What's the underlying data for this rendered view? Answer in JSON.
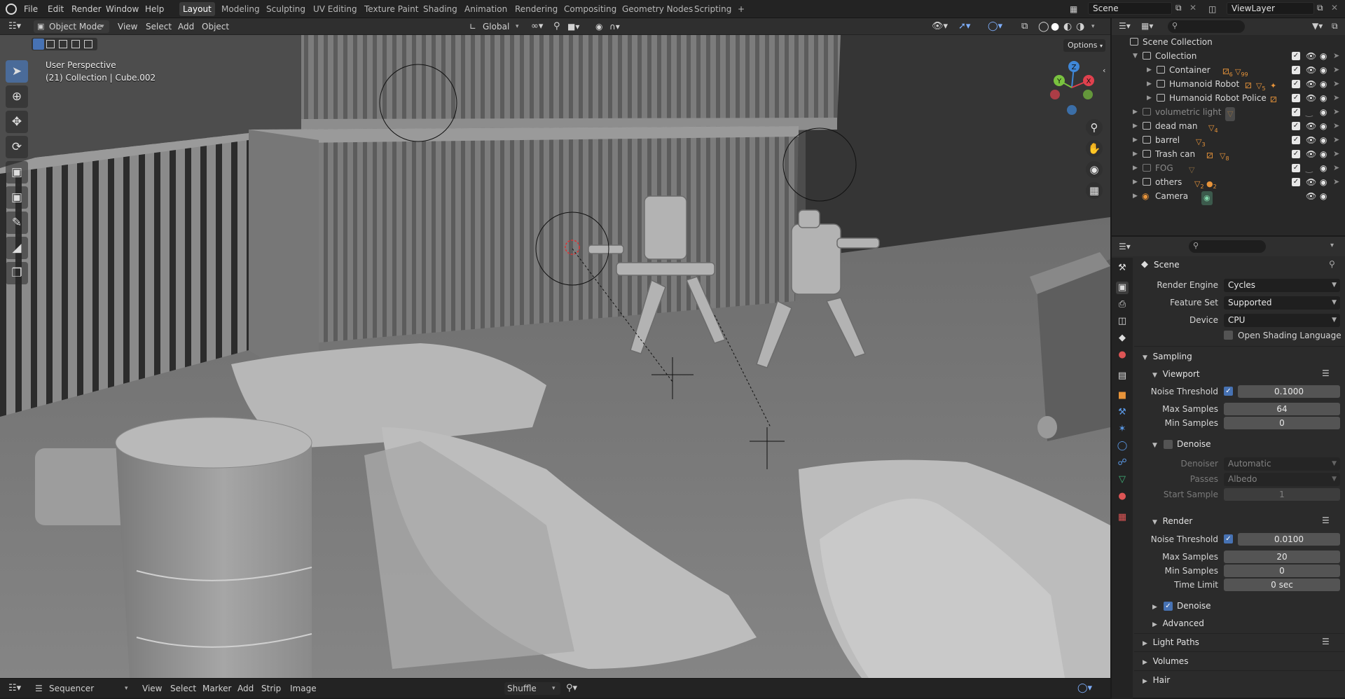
{
  "topbar": {
    "menus": [
      "File",
      "Edit",
      "Render",
      "Window",
      "Help"
    ],
    "workspaces": [
      "Layout",
      "Modeling",
      "Sculpting",
      "UV Editing",
      "Texture Paint",
      "Shading",
      "Animation",
      "Rendering",
      "Compositing",
      "Geometry Nodes",
      "Scripting"
    ],
    "active_workspace": "Layout",
    "add_tab": "+",
    "scene_name": "Scene",
    "view_layer": "ViewLayer"
  },
  "viewport_header": {
    "mode": "Object Mode",
    "menus": [
      "View",
      "Select",
      "Add",
      "Object"
    ],
    "orientation": "Global",
    "options": "Options"
  },
  "viewport": {
    "perspective_label": "User Perspective",
    "collection_label": "(21) Collection | Cube.002",
    "gizmo_axes": [
      "Z",
      "Y",
      "X"
    ]
  },
  "toolbar_icons": [
    "select-box-icon",
    "cursor-icon",
    "move-icon",
    "rotate-icon",
    "scale-icon",
    "transform-icon",
    "annotate-icon",
    "measure-icon",
    "add-cube-icon"
  ],
  "outliner": {
    "root": "Scene Collection",
    "rows": [
      {
        "label": "Collection",
        "indent": 0,
        "open": true,
        "dim": false
      },
      {
        "label": "Container",
        "indent": 1,
        "open": false,
        "dim": false
      },
      {
        "label": "Humanoid Robot",
        "indent": 1,
        "open": false,
        "dim": false
      },
      {
        "label": "Humanoid Robot Police",
        "indent": 1,
        "open": false,
        "dim": false
      },
      {
        "label": "volumetric light",
        "indent": 0,
        "open": false,
        "dim": true
      },
      {
        "label": "dead man",
        "indent": 0,
        "open": false,
        "dim": false
      },
      {
        "label": "barrel",
        "indent": 0,
        "open": false,
        "dim": false
      },
      {
        "label": "Trash can",
        "indent": 0,
        "open": false,
        "dim": false
      },
      {
        "label": "FOG",
        "indent": 0,
        "open": false,
        "dim": true
      },
      {
        "label": "others",
        "indent": 0,
        "open": false,
        "dim": false
      },
      {
        "label": "Camera",
        "indent": 0,
        "open": false,
        "dim": false
      }
    ],
    "counts": {
      "container_a": "6",
      "container_b": "99",
      "robot_a": "5",
      "dead_man": "4",
      "barrel": "3",
      "trash": "8",
      "others_a": "2",
      "others_b": "2"
    }
  },
  "properties": {
    "context": "Scene",
    "render_engine_label": "Render Engine",
    "render_engine": "Cycles",
    "feature_set_label": "Feature Set",
    "feature_set": "Supported",
    "device_label": "Device",
    "device": "CPU",
    "osl_label": "Open Shading Language",
    "sampling": "Sampling",
    "viewport": {
      "title": "Viewport",
      "noise_threshold_label": "Noise Threshold",
      "noise_threshold": "0.1000",
      "max_samples_label": "Max Samples",
      "max_samples": "64",
      "min_samples_label": "Min Samples",
      "min_samples": "0",
      "denoise_label": "Denoise",
      "denoiser_label": "Denoiser",
      "denoiser": "Automatic",
      "passes_label": "Passes",
      "passes": "Albedo",
      "start_sample_label": "Start Sample",
      "start_sample": "1"
    },
    "render": {
      "title": "Render",
      "noise_threshold_label": "Noise Threshold",
      "noise_threshold": "0.0100",
      "max_samples_label": "Max Samples",
      "max_samples": "20",
      "min_samples_label": "Min Samples",
      "min_samples": "0",
      "time_limit_label": "Time Limit",
      "time_limit": "0 sec",
      "denoise_label": "Denoise",
      "advanced_label": "Advanced"
    },
    "light_paths": "Light Paths",
    "volumes": "Volumes",
    "hair": "Hair"
  },
  "sequencer": {
    "type": "Sequencer",
    "menus": [
      "View",
      "Select",
      "Marker",
      "Add",
      "Strip",
      "Image"
    ],
    "shuffle": "Shuffle"
  },
  "colors": {
    "accent": "#4772b3",
    "x_axis": "#e0414e",
    "y_axis": "#79c23f",
    "z_axis": "#3f87d8"
  }
}
